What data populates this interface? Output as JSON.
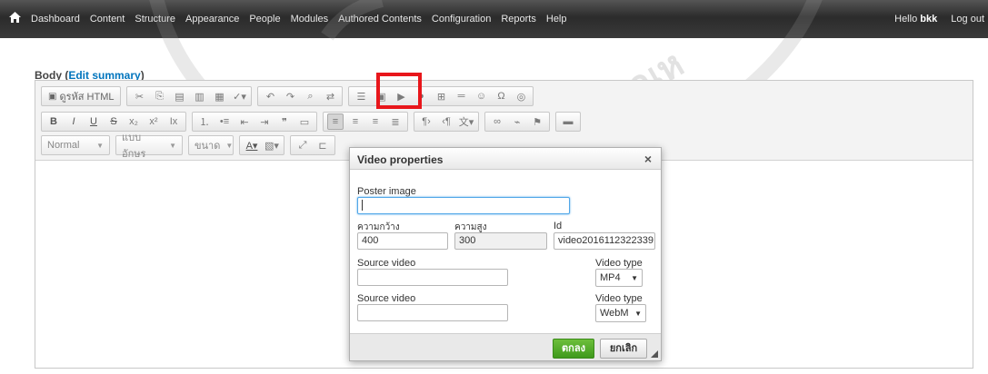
{
  "toolbar": {
    "menu": [
      "Dashboard",
      "Content",
      "Structure",
      "Appearance",
      "People",
      "Modules",
      "Authored Contents",
      "Configuration",
      "Reports",
      "Help"
    ],
    "hello_prefix": "Hello",
    "username": "bkk",
    "logout": "Log out"
  },
  "field": {
    "label": "Body",
    "edit_summary": "Edit summary"
  },
  "editor": {
    "source_label": "ดูรหัส HTML",
    "format_combo": "Normal",
    "font_combo": "แบบอักษร",
    "size_combo": "ขนาด"
  },
  "dialog": {
    "title": "Video properties",
    "close": "×",
    "poster_label": "Poster image",
    "poster_value": "",
    "width_label": "ความกว้าง",
    "width_value": "400",
    "height_label": "ความสูง",
    "height_value": "300",
    "id_label": "Id",
    "id_value": "video2016112322339",
    "source1_label": "Source video",
    "source1_value": "",
    "type1_label": "Video type",
    "type1_value": "MP4",
    "source2_label": "Source video",
    "source2_value": "",
    "type2_label": "Video type",
    "type2_value": "WebM",
    "ok": "ตกลง",
    "cancel": "ยกเลิก"
  },
  "colors": {
    "toolbar_bg": "#2b2b2b",
    "link": "#0074bd",
    "ok_green": "#4aa624",
    "highlight_red": "#e8161b"
  }
}
